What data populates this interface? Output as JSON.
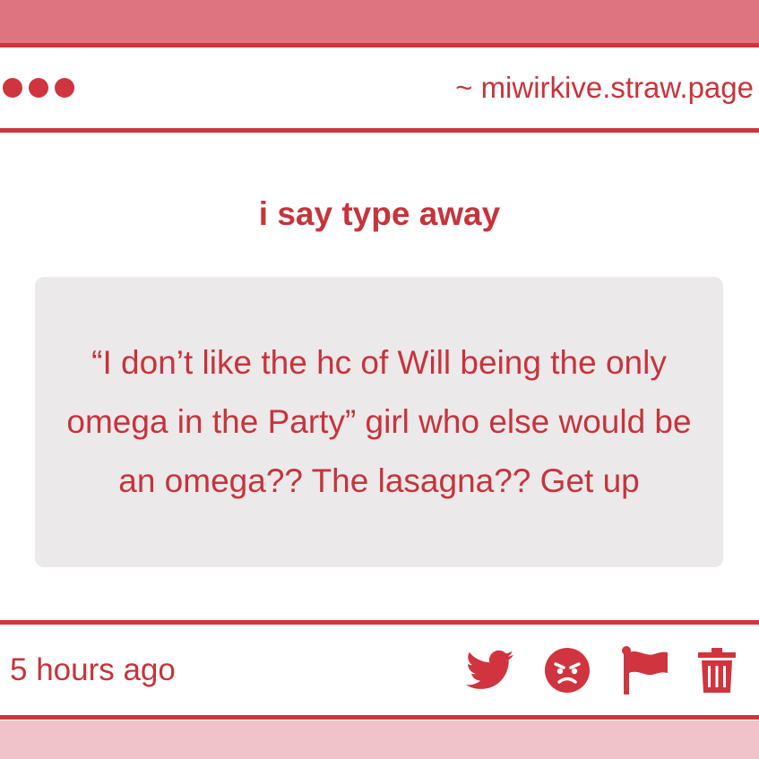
{
  "window": {
    "url": "~ miwirkive.straw.page"
  },
  "post": {
    "title": "i say type away",
    "message": "“I don’t like the hc of Will being the only omega in the Party” girl who else would be an omega?? The lasagna?? Get up",
    "timestamp": "5 hours ago"
  },
  "actions": [
    "twitter-icon",
    "angry-face-icon",
    "flag-icon",
    "trash-icon"
  ],
  "colors": {
    "accent": "#d0343e",
    "text": "#c8333b",
    "top_band": "#de7480",
    "bottom_band": "#f0c3cb",
    "message_bg": "#ebe9ea"
  }
}
